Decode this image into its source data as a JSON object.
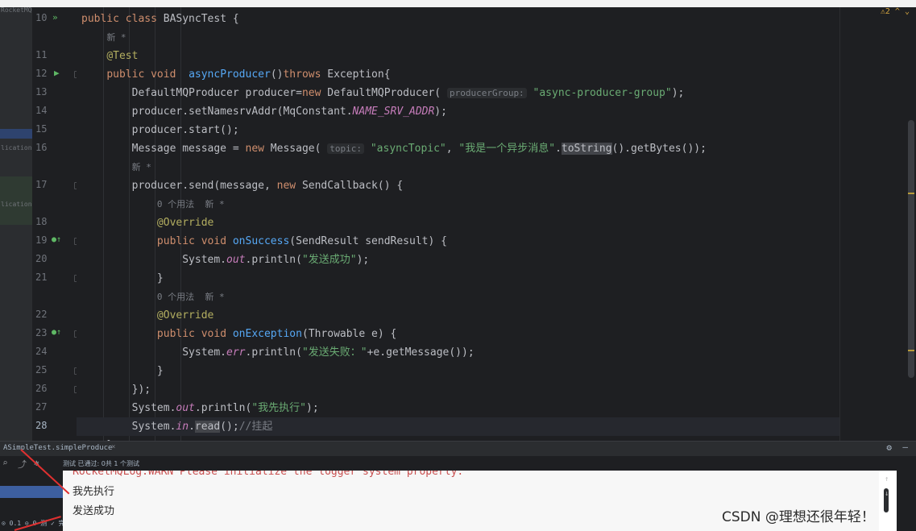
{
  "left_panel": {
    "labels": [
      "RocketMQ",
      "lication",
      "lication"
    ]
  },
  "gutter": {
    "line_numbers": [
      "10",
      "11",
      "12",
      "13",
      "14",
      "15",
      "16",
      "17",
      "18",
      "19",
      "20",
      "21",
      "22",
      "23",
      "24",
      "25",
      "26",
      "27",
      "28"
    ]
  },
  "editor": {
    "lines": [
      {
        "ln": "10",
        "html": "<span class=\"kw\">public class</span> BASyncTest {"
      },
      {
        "ln": "",
        "html": "    <span class=\"lens\">新 *</span>"
      },
      {
        "ln": "11",
        "html": "    <span class=\"ann\">@Test</span>"
      },
      {
        "ln": "12",
        "html": "    <span class=\"kw\">public void</span>  <span class=\"fn\">asyncProducer</span>()<span class=\"kw\">throws</span> Exception{"
      },
      {
        "ln": "13",
        "html": "        DefaultMQProducer producer=<span class=\"kw\">new</span> DefaultMQProducer( <span class=\"hint\">producerGroup:</span> <span class=\"str\">\"async-producer-group\"</span>);"
      },
      {
        "ln": "14",
        "html": "        producer.setNamesrvAddr(MqConstant.<span class=\"it\">NAME_SRV_ADDR</span>);"
      },
      {
        "ln": "15",
        "html": "        producer.start();"
      },
      {
        "ln": "16",
        "html": "        Message message = <span class=\"kw\">new</span> Message( <span class=\"hint\">topic:</span> <span class=\"str\">\"asyncTopic\"</span>, <span class=\"str\">\"我是一个异步消息\"</span>.<span class=\"hl\">toString</span>().getBytes());"
      },
      {
        "ln": "",
        "html": "        <span class=\"lens\">新 *</span>"
      },
      {
        "ln": "17",
        "html": "        producer.send(message, <span class=\"kw\">new</span> SendCallback() {"
      },
      {
        "ln": "",
        "html": "            <span class=\"lens\">0 个用法  新 *</span>"
      },
      {
        "ln": "18",
        "html": "            <span class=\"ann\">@Override</span>"
      },
      {
        "ln": "19",
        "html": "            <span class=\"kw\">public void</span> <span class=\"fn\">onSuccess</span>(SendResult sendResult) {"
      },
      {
        "ln": "20",
        "html": "                System.<span class=\"it\">out</span>.println(<span class=\"str\">\"发送成功\"</span>);"
      },
      {
        "ln": "21",
        "html": "            }"
      },
      {
        "ln": "",
        "html": "            <span class=\"lens\">0 个用法  新 *</span>"
      },
      {
        "ln": "22",
        "html": "            <span class=\"ann\">@Override</span>"
      },
      {
        "ln": "23",
        "html": "            <span class=\"kw\">public void</span> <span class=\"fn\">onException</span>(Throwable e) {"
      },
      {
        "ln": "24",
        "html": "                System.<span class=\"it\">err</span>.println(<span class=\"str\">\"发送失败：\"</span>+e.getMessage());"
      },
      {
        "ln": "25",
        "html": "            }"
      },
      {
        "ln": "26",
        "html": "        });"
      },
      {
        "ln": "27",
        "html": "        System.<span class=\"it\">out</span>.println(<span class=\"str\">\"我先执行\"</span>);"
      },
      {
        "ln": "28",
        "html": "        System.<span class=\"it\">in</span>.<span class=\"hl\">read</span>();<span class=\"cmt\">//挂起</span>"
      },
      {
        "ln": "",
        "html": "    }"
      }
    ]
  },
  "warnings": {
    "indicator": "⚠2 ^ ⌄"
  },
  "run_panel": {
    "tab_label": "ASimpleTest.simpleProduce",
    "test_summary": "测试 已通过: 0共 1 个测试",
    "tree_footer": "⊙ 0.1 ⊙ 0 测  ✓ 完成",
    "console_lines": [
      "RocketMQLog:WARN Please initialize the logger system properly.",
      "我先执行",
      "发送成功"
    ]
  },
  "watermark": "CSDN @理想还很年轻！",
  "colors": {
    "accent_red": "#e03030",
    "keyword": "#cf8e6d",
    "string": "#6aab73"
  }
}
